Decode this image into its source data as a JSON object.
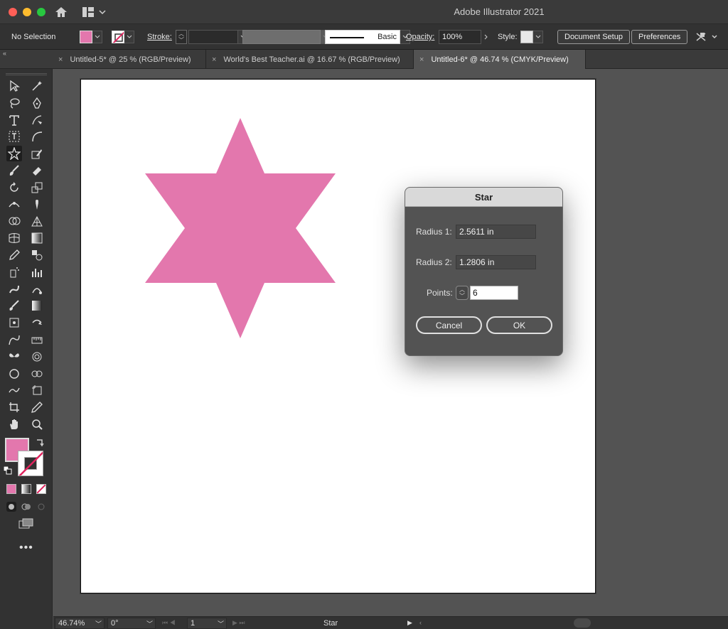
{
  "app": {
    "title": "Adobe Illustrator 2021"
  },
  "control_bar": {
    "selection": "No Selection",
    "fill_color": "#e377ad",
    "stroke_label": "Stroke:",
    "brush": "Basic",
    "opacity_label": "Opacity:",
    "opacity_value": "100%",
    "style_label": "Style:",
    "document_setup": "Document Setup",
    "preferences": "Preferences"
  },
  "tabs": [
    {
      "label": "Untitled-5* @ 25 % (RGB/Preview)",
      "active": false
    },
    {
      "label": "World's Best Teacher.ai @ 16.67 % (RGB/Preview)",
      "active": false
    },
    {
      "label": "Untitled-6* @ 46.74 % (CMYK/Preview)",
      "active": true
    }
  ],
  "tools": [
    "selection-tool-icon",
    "magic-wand-icon",
    "lasso-icon",
    "pen-tool-icon",
    "type-tool-icon",
    "curvature-tool-icon",
    "touch-type-icon",
    "arc-icon",
    "star-tool-icon",
    "shaper-tool-icon",
    "paintbrush-icon",
    "eraser-icon",
    "rotate-tool-icon",
    "scale-tool-icon",
    "width-tool-icon",
    "puppet-warp-icon",
    "shape-builder-icon",
    "perspective-grid-icon",
    "mesh-tool-icon",
    "gradient-tool-icon",
    "eyedropper-icon",
    "blend-tool-icon",
    "symbol-sprayer-icon",
    "column-graph-icon",
    "blob-brush-icon",
    "shape-modifier-icon",
    "paintbrush-alt-icon",
    "gradient-swatch-icon",
    "free-transform-icon",
    "live-paint-selection-icon",
    "warp-tool-icon",
    "rulers-icon",
    "butterfly-icon",
    "twirl-icon",
    "circle-icon",
    "link-icon",
    "smooth-tool-icon",
    "artboard-tool-icon",
    "crop-icon",
    "pencil-icon",
    "hand-tool-icon",
    "zoom-tool-icon"
  ],
  "colors": {
    "fill": "#e377ad",
    "stroke": "#ffffff",
    "star": "#e377ad"
  },
  "dialog": {
    "title": "Star",
    "radius1_label": "Radius 1:",
    "radius1_value": "2.5611 in",
    "radius2_label": "Radius 2:",
    "radius2_value": "1.2806 in",
    "points_label": "Points:",
    "points_value": "6",
    "cancel": "Cancel",
    "ok": "OK"
  },
  "status_bar": {
    "zoom": "46.74%",
    "rotation": "0°",
    "artboard_number": "1",
    "current_tool": "Star"
  }
}
